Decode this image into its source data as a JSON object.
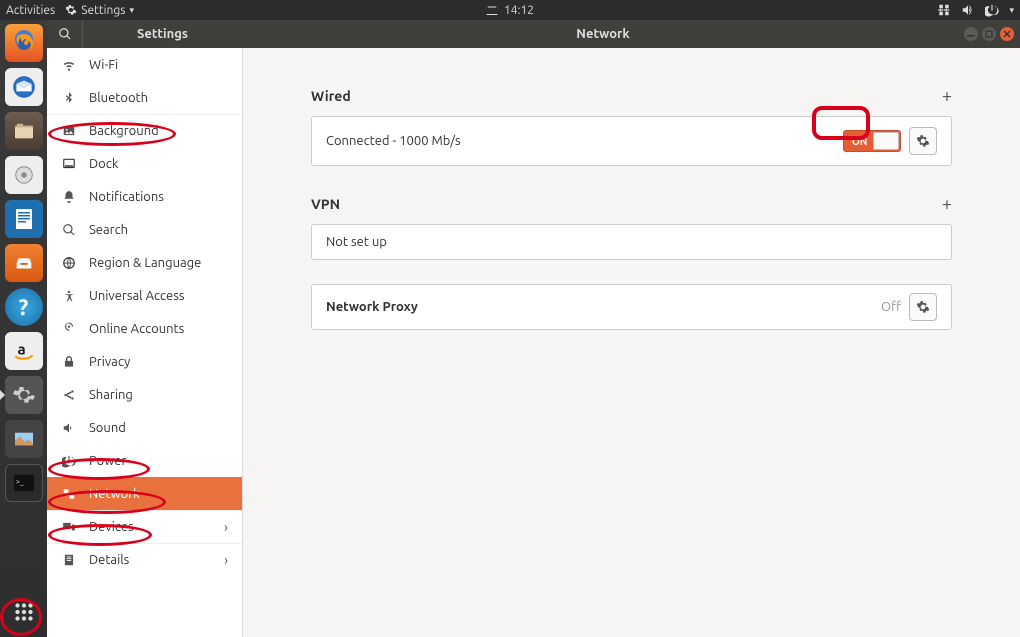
{
  "top_panel": {
    "activities": "Activities",
    "app_menu": "Settings",
    "clock": "14:12",
    "clock_prefix": "二"
  },
  "title_bar": {
    "sidebar_title": "Settings",
    "main_title": "Network"
  },
  "sidebar": {
    "items": [
      {
        "id": "wifi",
        "label": "Wi-Fi",
        "icon": "wifi"
      },
      {
        "id": "bluetooth",
        "label": "Bluetooth",
        "icon": "bluetooth"
      },
      {
        "id": "background",
        "label": "Background",
        "icon": "background",
        "group_top": true
      },
      {
        "id": "dock",
        "label": "Dock",
        "icon": "dock"
      },
      {
        "id": "notifications",
        "label": "Notifications",
        "icon": "bell"
      },
      {
        "id": "search",
        "label": "Search",
        "icon": "search"
      },
      {
        "id": "region",
        "label": "Region & Language",
        "icon": "globe"
      },
      {
        "id": "universal",
        "label": "Universal Access",
        "icon": "accessibility"
      },
      {
        "id": "online",
        "label": "Online Accounts",
        "icon": "online"
      },
      {
        "id": "privacy",
        "label": "Privacy",
        "icon": "lock"
      },
      {
        "id": "sharing",
        "label": "Sharing",
        "icon": "share"
      },
      {
        "id": "sound",
        "label": "Sound",
        "icon": "sound"
      },
      {
        "id": "power",
        "label": "Power",
        "icon": "power"
      },
      {
        "id": "network",
        "label": "Network",
        "icon": "network",
        "active": true
      },
      {
        "id": "devices",
        "label": "Devices",
        "icon": "devices",
        "group_top": true,
        "chevron": true
      },
      {
        "id": "details",
        "label": "Details",
        "icon": "details",
        "group_top": true,
        "chevron": true
      }
    ]
  },
  "content": {
    "wired": {
      "heading": "Wired",
      "status": "Connected - 1000 Mb/s",
      "toggle_label": "ON",
      "toggle_on": true
    },
    "vpn": {
      "heading": "VPN",
      "status": "Not set up"
    },
    "proxy": {
      "heading": "Network Proxy",
      "status": "Off"
    }
  },
  "launcher": {
    "items": [
      "firefox",
      "thunderbird",
      "files",
      "rhythmbox",
      "writer",
      "software",
      "help",
      "amazon",
      "settings",
      "screenshot",
      "terminal"
    ]
  }
}
